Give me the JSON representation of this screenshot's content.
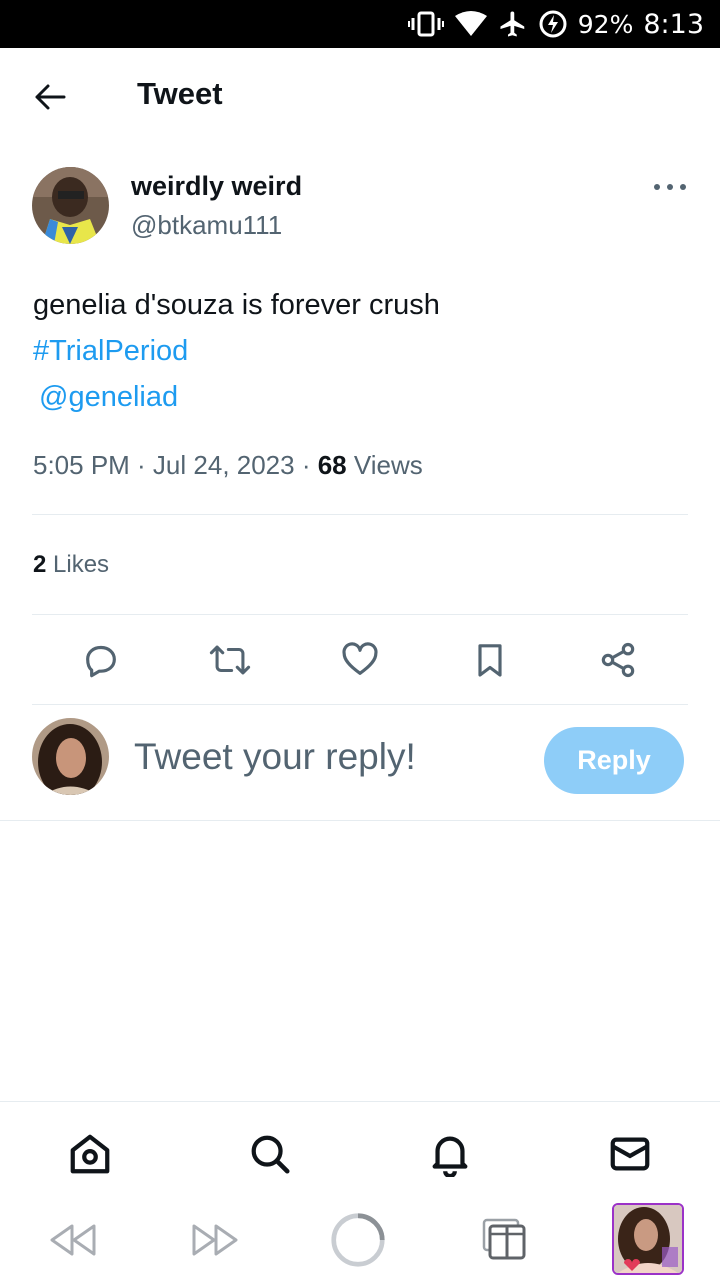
{
  "status_bar": {
    "battery_percent": "92%",
    "time": "8:13",
    "icons": [
      "vibrate-icon",
      "wifi-icon",
      "airplane-icon",
      "battery-charging-icon"
    ]
  },
  "header": {
    "title": "Tweet",
    "back_icon": "back-arrow-icon"
  },
  "tweet": {
    "author_name": "weirdly weird",
    "author_handle": "@btkamu111",
    "text": "genelia d'souza is forever crush",
    "hashtag": "#TrialPeriod",
    "mention": "@geneliad",
    "timestamp": "5:05 PM · Jul 24, 2023 · ",
    "views_count": "68",
    "views_label": " Views",
    "likes_count": "2",
    "likes_label": " Likes"
  },
  "actions": [
    "reply-icon",
    "retweet-icon",
    "like-icon",
    "bookmark-icon",
    "share-icon"
  ],
  "reply": {
    "placeholder": "Tweet your reply!",
    "button_label": "Reply"
  },
  "bottom_nav": [
    "home-icon",
    "search-icon",
    "notifications-icon",
    "messages-icon"
  ],
  "browser_bar": [
    "back-icon",
    "forward-icon",
    "reload-icon",
    "tabs-icon"
  ],
  "colors": {
    "accent": "#1d9bf0",
    "reply_button": "#8ecdf8",
    "secondary_text": "#536471"
  }
}
